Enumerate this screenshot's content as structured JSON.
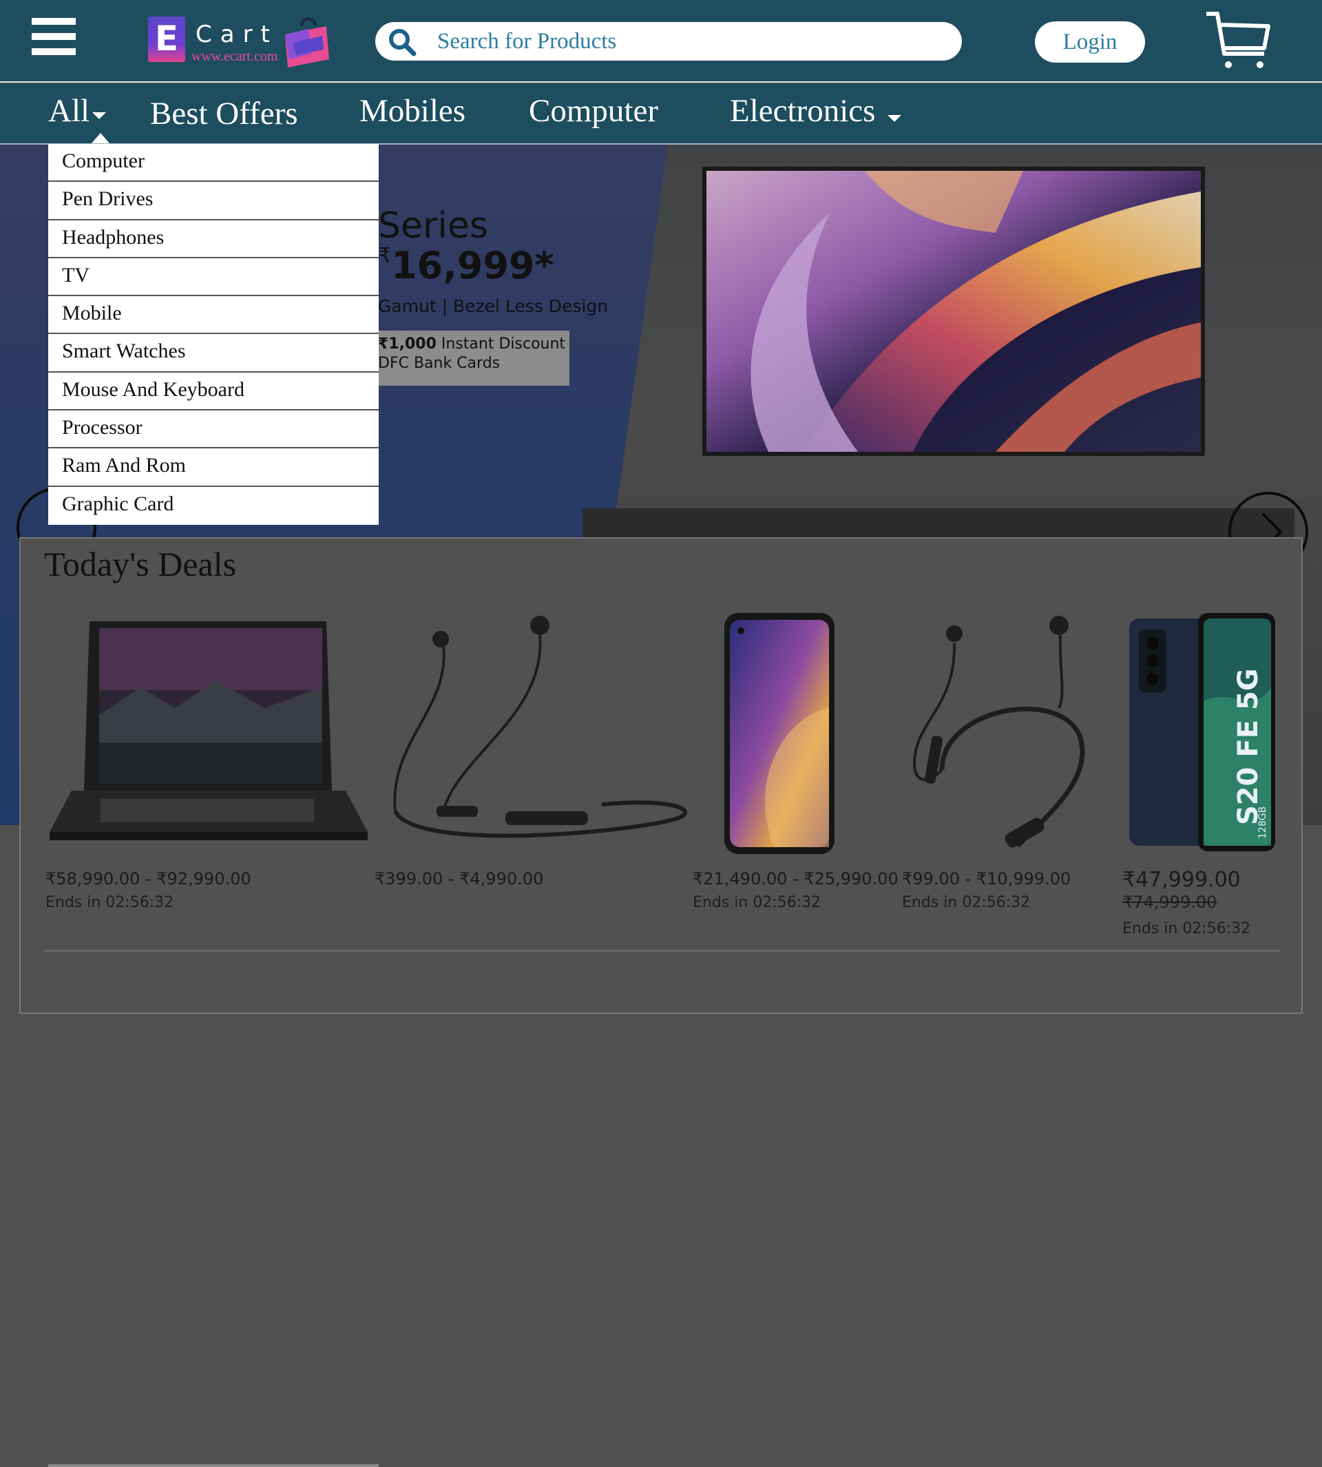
{
  "header": {
    "logo": {
      "word": "Cart",
      "letter": "E",
      "url": "www.ecart.com"
    },
    "search": {
      "placeholder": "Search for Products",
      "value": ""
    },
    "login_label": "Login"
  },
  "nav": {
    "items": [
      {
        "label": "All",
        "has_dropdown": true
      },
      {
        "label": "Best Offers"
      },
      {
        "label": "Mobiles"
      },
      {
        "label": "Computer"
      },
      {
        "label": "Electronics",
        "has_dropdown": true
      }
    ]
  },
  "dropdown": {
    "items": [
      "Computer",
      "Pen Drives",
      "Headphones",
      "TV",
      "Mobile",
      "Smart Watches",
      "Mouse And Keyboard",
      "Processor",
      "Ram And Rom",
      "Graphic Card"
    ]
  },
  "hero": {
    "series": "Series",
    "price_symbol": "₹",
    "price": "16,999*",
    "features": "Gamut | Bezel Less Design",
    "offer_line1_bold": "₹1,000",
    "offer_line1_rest": " Instant Discount",
    "offer_line2": "DFC Bank Cards"
  },
  "deals": {
    "title": "Today's Deals",
    "cards": [
      {
        "image": "laptop",
        "price": "₹58,990.00 - ₹92,990.00",
        "ends": "Ends in 02:56:32"
      },
      {
        "image": "neckband-earphones",
        "price": "₹399.00 - ₹4,990.00",
        "ends": ""
      },
      {
        "image": "smartphone",
        "price": "₹21,490.00 - ₹25,990.00",
        "ends": "Ends in 02:56:32"
      },
      {
        "image": "neckband-earphones",
        "price": "₹99.00 - ₹10,999.00",
        "ends": "Ends in 02:56:32"
      },
      {
        "image": "smartphone-s20",
        "price": "₹47,999.00",
        "old_price": "₹74,999.00",
        "ends": "Ends in 02:56:32",
        "phone_text": "S20 FE 5G",
        "storage": "128GB"
      }
    ]
  },
  "colors": {
    "header_bg": "#1d4d5e",
    "accent_text": "#2c7da0",
    "overlay_bg": "#505050",
    "logo_pink": "#e94b95"
  }
}
